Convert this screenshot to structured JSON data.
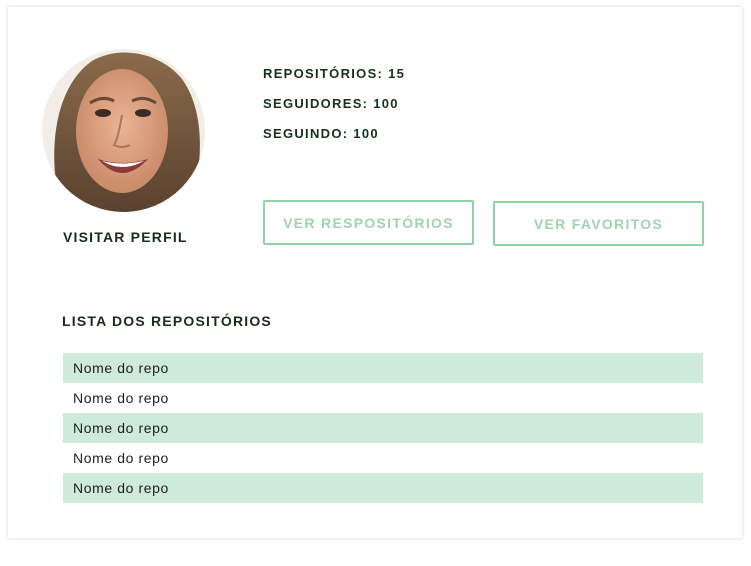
{
  "profile": {
    "visit_label": "VISITAR PERFIL"
  },
  "stats": {
    "repos": "REPOSITÓRIOS: 15",
    "followers": "SEGUIDORES: 100",
    "following": "SEGUINDO: 100"
  },
  "actions": {
    "view_repos_label": "VER RESPOSITÓRIOS",
    "view_favorites_label": "VER FAVORITOS"
  },
  "repo_list": {
    "title": "LISTA DOS REPOSITÓRIOS",
    "items": [
      {
        "name": "Nome do repo"
      },
      {
        "name": "Nome do repo"
      },
      {
        "name": "Nome do repo"
      },
      {
        "name": "Nome do repo"
      },
      {
        "name": "Nome do repo"
      }
    ]
  },
  "colors": {
    "accent": "#8fd3a5",
    "row_highlight": "#cdeadb",
    "text_dark": "#16301d"
  }
}
